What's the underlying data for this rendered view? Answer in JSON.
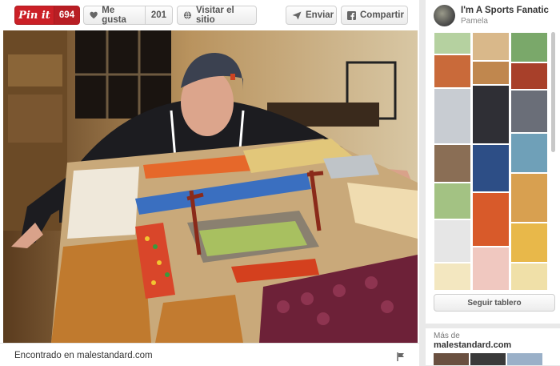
{
  "toolbar": {
    "pinit_label": "Pin it",
    "pinit_count": "694",
    "like_label": "Me gusta",
    "like_count": "201",
    "visit_label": "Visitar el sitio",
    "send_label": "Enviar",
    "share_label": "Compartir"
  },
  "footer": {
    "source_text": "Encontrado en malestandard.com"
  },
  "board": {
    "name": "I'm A Sports Fanatic",
    "owner": "Pamela",
    "follow_label": "Seguir tablero"
  },
  "more": {
    "label": "Más de",
    "domain": "malestandard.com"
  },
  "colors": {
    "pinterest_red": "#cb2027",
    "button_text": "#555555",
    "background": "#e9e9e9"
  }
}
